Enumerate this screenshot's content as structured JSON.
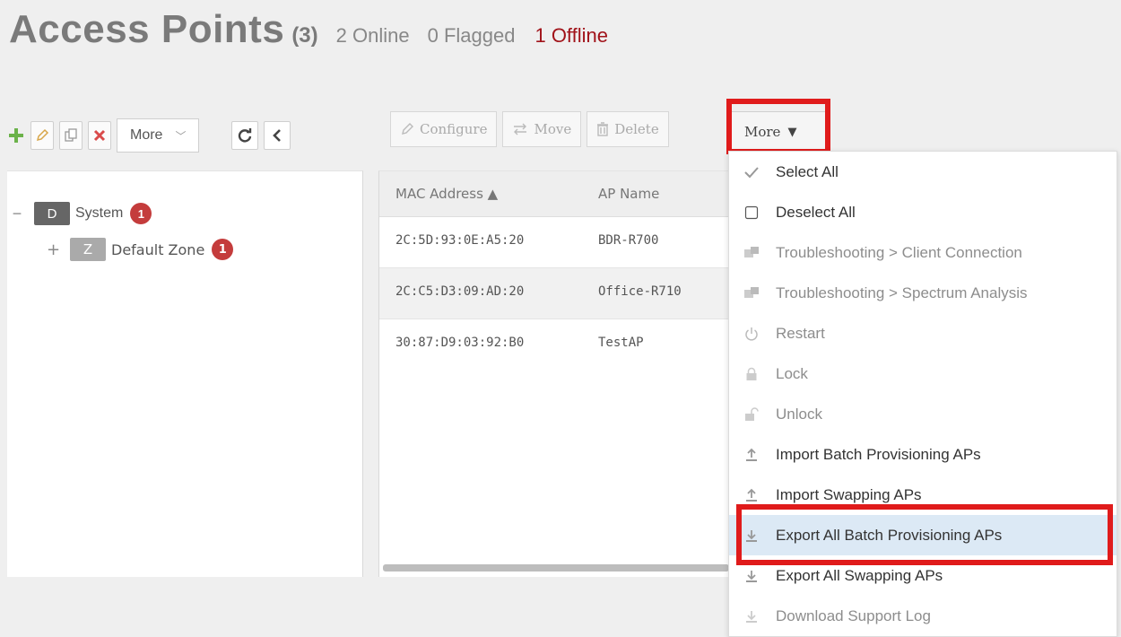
{
  "header": {
    "title": "Access Points",
    "count": "(3)",
    "online": "2 Online",
    "flagged": "0 Flagged",
    "offline": "1 Offline"
  },
  "left_toolbar": {
    "more_label": "More",
    "icons": [
      "add-icon",
      "edit-icon",
      "clone-icon",
      "delete-icon",
      "refresh-icon",
      "collapse-left-icon"
    ]
  },
  "tree": {
    "system": {
      "toggle": "−",
      "badge": "D",
      "label": "System",
      "count": "1"
    },
    "zone": {
      "toggle": "+",
      "badge": "Z",
      "label": "Default Zone",
      "count": "1"
    }
  },
  "actions": {
    "configure": "Configure",
    "move": "Move",
    "delete": "Delete",
    "more": "More"
  },
  "table": {
    "columns": [
      "MAC Address ▲",
      "AP Name"
    ],
    "rows": [
      {
        "mac": "2C:5D:93:0E:A5:20",
        "name": "BDR-R700"
      },
      {
        "mac": "2C:C5:D3:09:AD:20",
        "name": "Office-R710"
      },
      {
        "mac": "30:87:D9:03:92:B0",
        "name": "TestAP"
      }
    ]
  },
  "menu": {
    "items": [
      {
        "label": "Select All",
        "icon": "check-icon",
        "disabled": false
      },
      {
        "label": "Deselect All",
        "icon": "checkbox-icon",
        "disabled": false
      },
      {
        "label": "Troubleshooting > Client Connection",
        "icon": "troubleshoot-icon",
        "disabled": true
      },
      {
        "label": "Troubleshooting > Spectrum Analysis",
        "icon": "troubleshoot-icon",
        "disabled": true
      },
      {
        "label": "Restart",
        "icon": "power-icon",
        "disabled": true
      },
      {
        "label": "Lock",
        "icon": "lock-icon",
        "disabled": true
      },
      {
        "label": "Unlock",
        "icon": "unlock-icon",
        "disabled": true
      },
      {
        "label": "Import Batch Provisioning APs",
        "icon": "upload-icon",
        "disabled": false
      },
      {
        "label": "Import Swapping APs",
        "icon": "upload-icon",
        "disabled": false
      },
      {
        "label": "Export All Batch Provisioning APs",
        "icon": "download-icon",
        "disabled": false,
        "highlight": true
      },
      {
        "label": "Export All Swapping APs",
        "icon": "download-icon",
        "disabled": false
      },
      {
        "label": "Download Support Log",
        "icon": "download-icon",
        "disabled": true
      }
    ]
  },
  "colors": {
    "offline": "#a1131a",
    "badge_red": "#c43c3c",
    "highlight_box": "#e01b1b",
    "menu_highlight": "#dce9f5"
  }
}
